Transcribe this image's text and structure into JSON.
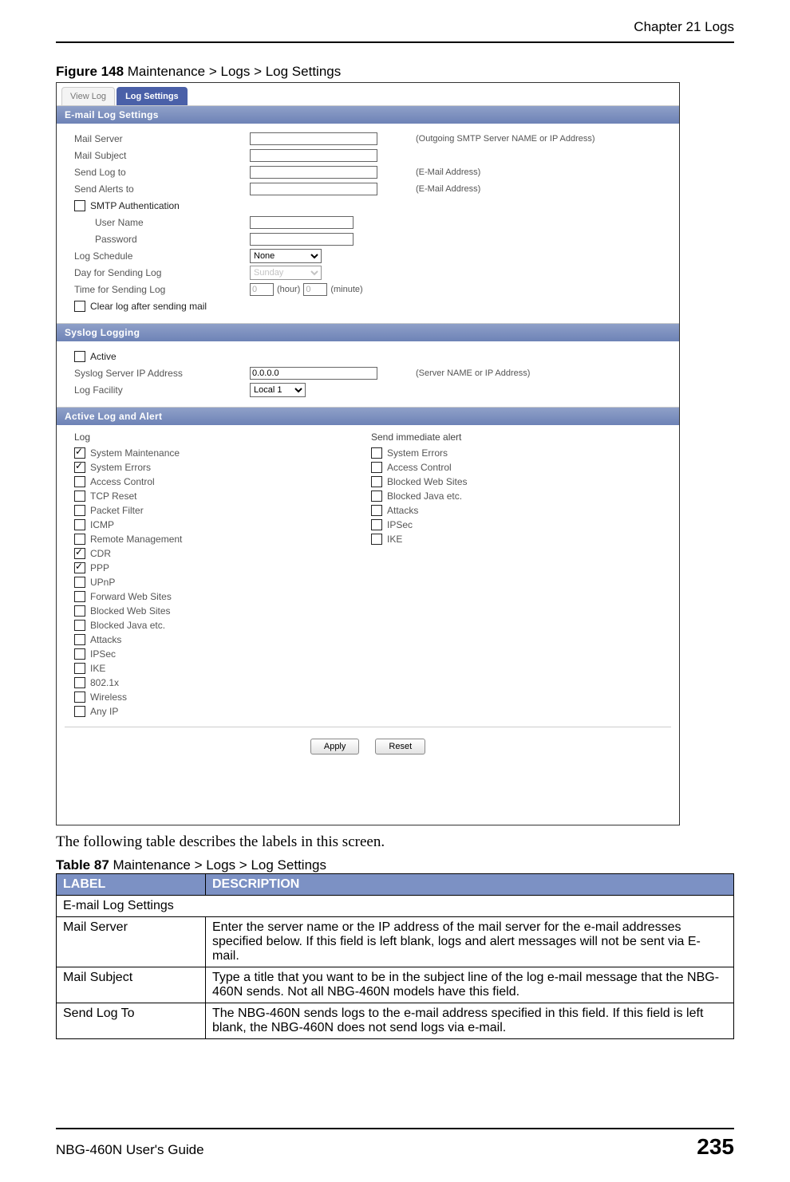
{
  "chapter_header": "Chapter 21 Logs",
  "figure_caption_bold": "Figure 148",
  "figure_caption_rest": "   Maintenance > Logs > Log Settings",
  "screenshot": {
    "tabs": [
      {
        "label": "View Log",
        "active": false
      },
      {
        "label": "Log Settings",
        "active": true
      }
    ],
    "sections": {
      "email": {
        "title": "E-mail Log Settings",
        "mail_server_label": "Mail Server",
        "mail_server_hint": "(Outgoing SMTP Server NAME or IP Address)",
        "mail_subject_label": "Mail Subject",
        "send_log_to_label": "Send Log to",
        "send_log_to_hint": "(E-Mail Address)",
        "send_alerts_to_label": "Send Alerts to",
        "send_alerts_to_hint": "(E-Mail Address)",
        "smtp_auth_label": "SMTP Authentication",
        "smtp_auth_checked": false,
        "user_name_label": "User Name",
        "password_label": "Password",
        "log_schedule_label": "Log Schedule",
        "log_schedule_value": "None",
        "day_label": "Day for Sending Log",
        "day_value": "Sunday",
        "time_label": "Time for Sending Log",
        "time_hour_value": "0",
        "time_hour_hint": "(hour)",
        "time_min_value": "0",
        "time_min_hint": "(minute)",
        "clear_log_label": "Clear log after sending mail",
        "clear_log_checked": false
      },
      "syslog": {
        "title": "Syslog Logging",
        "active_label": "Active",
        "active_checked": false,
        "server_label": "Syslog Server IP Address",
        "server_value": "0.0.0.0",
        "server_hint": "(Server NAME or IP Address)",
        "facility_label": "Log Facility",
        "facility_value": "Local 1"
      },
      "active_log": {
        "title": "Active Log and Alert",
        "log_header": "Log",
        "alert_header": "Send immediate alert",
        "log_items": [
          {
            "label": "System Maintenance",
            "checked": true
          },
          {
            "label": "System Errors",
            "checked": true
          },
          {
            "label": "Access Control",
            "checked": false
          },
          {
            "label": "TCP Reset",
            "checked": false
          },
          {
            "label": "Packet Filter",
            "checked": false
          },
          {
            "label": "ICMP",
            "checked": false
          },
          {
            "label": "Remote Management",
            "checked": false
          },
          {
            "label": "CDR",
            "checked": true
          },
          {
            "label": "PPP",
            "checked": true
          },
          {
            "label": "UPnP",
            "checked": false
          },
          {
            "label": "Forward Web Sites",
            "checked": false
          },
          {
            "label": "Blocked Web Sites",
            "checked": false
          },
          {
            "label": "Blocked Java etc.",
            "checked": false
          },
          {
            "label": "Attacks",
            "checked": false
          },
          {
            "label": "IPSec",
            "checked": false
          },
          {
            "label": "IKE",
            "checked": false
          },
          {
            "label": "802.1x",
            "checked": false
          },
          {
            "label": "Wireless",
            "checked": false
          },
          {
            "label": "Any IP",
            "checked": false
          }
        ],
        "alert_items": [
          {
            "label": "System Errors",
            "checked": false
          },
          {
            "label": "Access Control",
            "checked": false
          },
          {
            "label": "Blocked Web Sites",
            "checked": false
          },
          {
            "label": "Blocked Java etc.",
            "checked": false
          },
          {
            "label": "Attacks",
            "checked": false
          },
          {
            "label": "IPSec",
            "checked": false
          },
          {
            "label": "IKE",
            "checked": false
          }
        ]
      }
    },
    "buttons": {
      "apply": "Apply",
      "reset": "Reset"
    }
  },
  "body_text": "The following table describes the labels in this screen.",
  "table_caption_bold": "Table 87",
  "table_caption_rest": "   Maintenance > Logs > Log Settings",
  "table": {
    "headers": {
      "label": "LABEL",
      "description": "DESCRIPTION"
    },
    "rows": [
      {
        "label": "E-mail Log Settings",
        "description": "",
        "section": true
      },
      {
        "label": "Mail Server",
        "description": "Enter the server name or the IP address of the mail server for the e-mail addresses specified below. If this field is left blank, logs and alert messages will not be sent via E-mail."
      },
      {
        "label": "Mail Subject",
        "description": "Type a title that you want to be in the subject line of the log e-mail message that the NBG-460N sends. Not all NBG-460N models have this field."
      },
      {
        "label": "Send Log To",
        "description": "The NBG-460N sends logs to the e-mail address specified in this field. If this field is left blank, the NBG-460N does not send logs via e-mail."
      }
    ]
  },
  "footer": {
    "guide": "NBG-460N User's Guide",
    "page": "235"
  }
}
